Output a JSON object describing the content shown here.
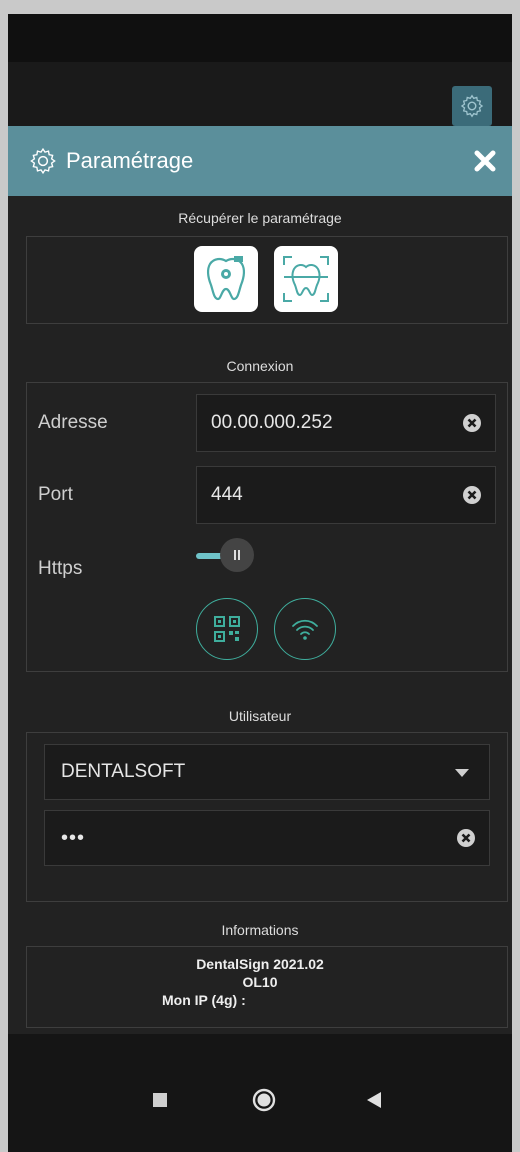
{
  "header": {
    "title": "Paramétrage"
  },
  "recover": {
    "section_title": "Récupérer le paramétrage"
  },
  "connexion": {
    "section_title": "Connexion",
    "address_label": "Adresse",
    "address_value": "00.00.000.252",
    "port_label": "Port",
    "port_value": "444",
    "https_label": "Https",
    "https_enabled": true
  },
  "utilisateur": {
    "section_title": "Utilisateur",
    "selected_user": "DENTALSOFT",
    "password_mask": "•••"
  },
  "informations": {
    "section_title": "Informations",
    "app_version": "DentalSign 2021.02",
    "code": "OL10",
    "ip_label": "Mon IP (4g) :"
  },
  "colors": {
    "header_bg": "#5b8f9b",
    "accent": "#6fc3c9",
    "ring": "#3fae9d"
  }
}
